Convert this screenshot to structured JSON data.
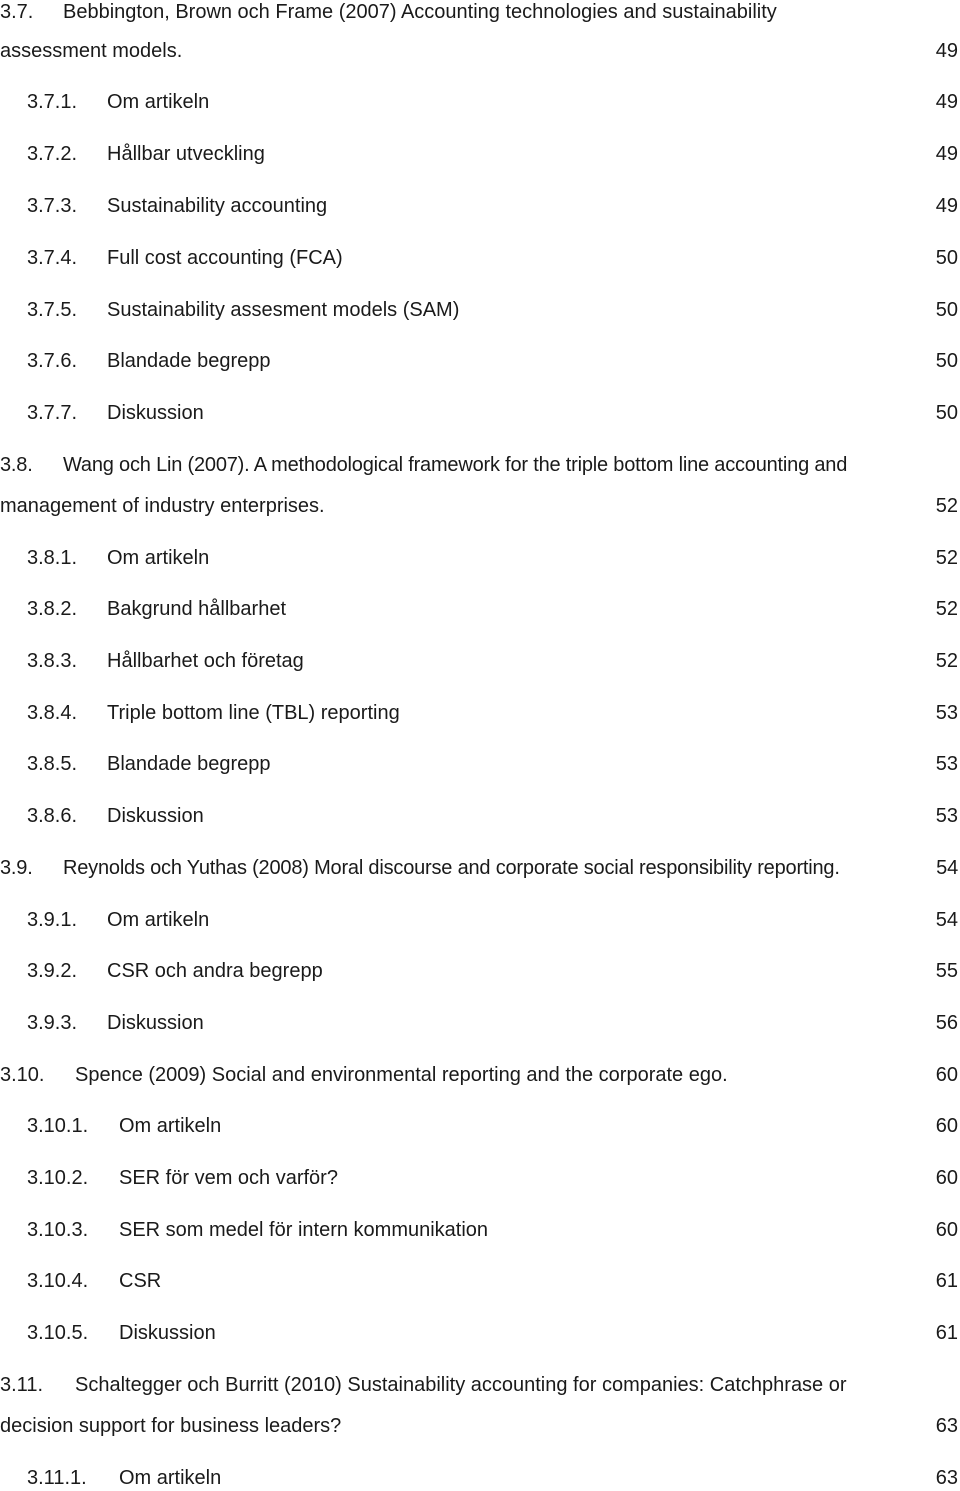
{
  "toc": {
    "entries": [
      {
        "number": "3.7.",
        "title_line1": "Bebbington, Brown och Frame (2007) Accounting technologies and sustainability",
        "title_line2": "assessment models.",
        "page": "49"
      },
      {
        "number": "3.7.1.",
        "title": "Om artikeln",
        "page": "49"
      },
      {
        "number": "3.7.2.",
        "title": "Hållbar utveckling",
        "page": "49"
      },
      {
        "number": "3.7.3.",
        "title": "Sustainability accounting",
        "page": "49"
      },
      {
        "number": "3.7.4.",
        "title": "Full cost accounting (FCA)",
        "page": "50"
      },
      {
        "number": "3.7.5.",
        "title": "Sustainability assesment models (SAM)",
        "page": "50"
      },
      {
        "number": "3.7.6.",
        "title": "Blandade begrepp",
        "page": "50"
      },
      {
        "number": "3.7.7.",
        "title": "Diskussion",
        "page": "50"
      },
      {
        "number": "3.8.",
        "title_line1": "Wang och Lin (2007). A methodological framework for the triple bottom line accounting and",
        "title_line2": "management of industry enterprises.",
        "page": "52"
      },
      {
        "number": "3.8.1.",
        "title": "Om artikeln",
        "page": "52"
      },
      {
        "number": "3.8.2.",
        "title": "Bakgrund hållbarhet",
        "page": "52"
      },
      {
        "number": "3.8.3.",
        "title": "Hållbarhet och företag",
        "page": "52"
      },
      {
        "number": "3.8.4.",
        "title": "Triple bottom line (TBL) reporting",
        "page": "53"
      },
      {
        "number": "3.8.5.",
        "title": "Blandade begrepp",
        "page": "53"
      },
      {
        "number": "3.8.6.",
        "title": "Diskussion",
        "page": "53"
      },
      {
        "number": "3.9.",
        "title": "Reynolds och Yuthas (2008) Moral discourse and corporate social responsibility reporting.",
        "page": "54"
      },
      {
        "number": "3.9.1.",
        "title": "Om artikeln",
        "page": "54"
      },
      {
        "number": "3.9.2.",
        "title": "CSR och andra begrepp",
        "page": "55"
      },
      {
        "number": "3.9.3.",
        "title": "Diskussion",
        "page": "56"
      },
      {
        "number": "3.10.",
        "title": "Spence (2009) Social and environmental reporting and the corporate ego.",
        "page": "60"
      },
      {
        "number": "3.10.1.",
        "title": "Om artikeln",
        "page": "60"
      },
      {
        "number": "3.10.2.",
        "title": "SER för vem och varför?",
        "page": "60"
      },
      {
        "number": "3.10.3.",
        "title": "SER som medel för intern kommunikation",
        "page": "60"
      },
      {
        "number": "3.10.4.",
        "title": "CSR",
        "page": "61"
      },
      {
        "number": "3.10.5.",
        "title": "Diskussion",
        "page": "61"
      },
      {
        "number": "3.11.",
        "title_line1": "Schaltegger och Burritt (2010) Sustainability accounting for companies: Catchphrase or",
        "title_line2": "decision support for business leaders?",
        "page": "63"
      },
      {
        "number": "3.11.1.",
        "title": "Om artikeln",
        "page": "63"
      }
    ]
  }
}
